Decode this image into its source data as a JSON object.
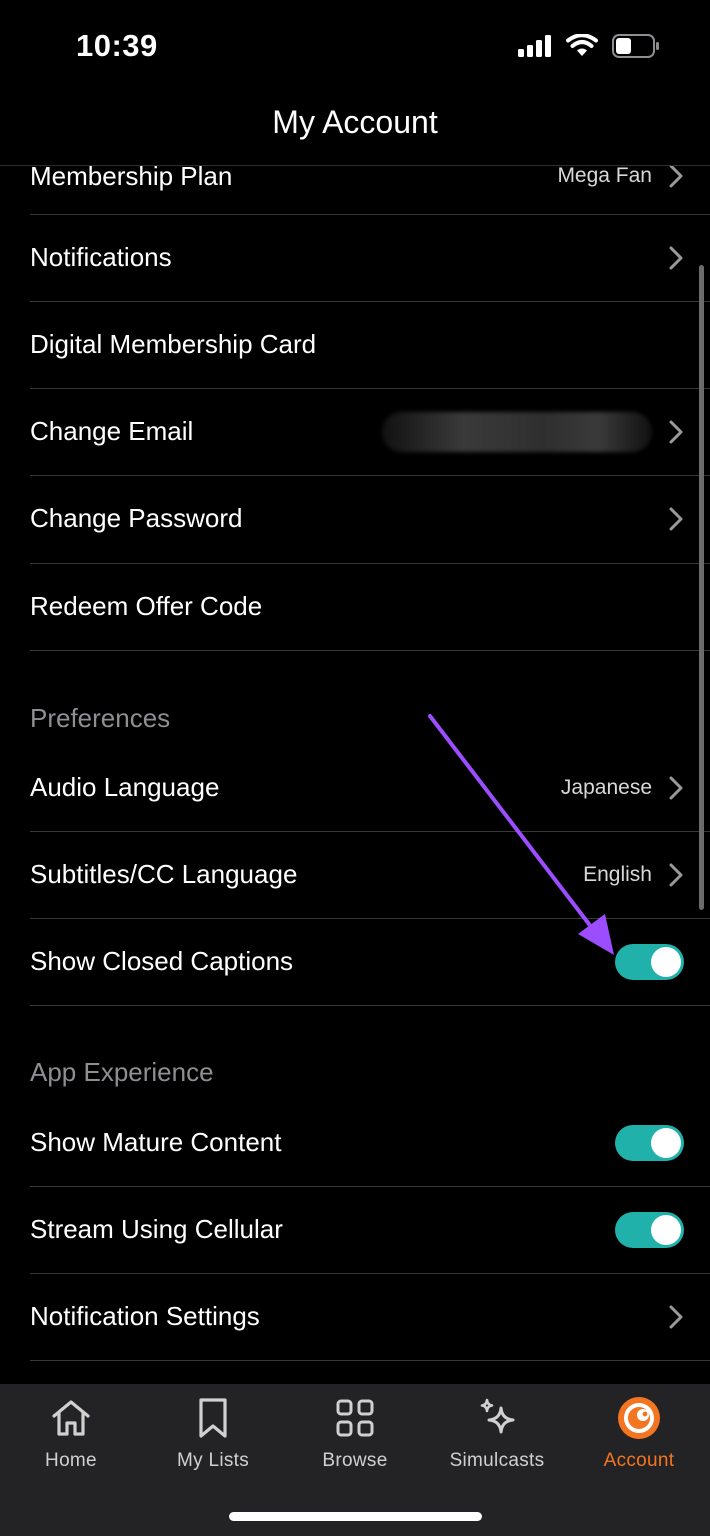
{
  "status_bar": {
    "time": "10:39"
  },
  "nav": {
    "title": "My Account"
  },
  "account_rows": [
    {
      "label": "Membership Plan",
      "value": "Mega Fan"
    },
    {
      "label": "Notifications"
    },
    {
      "label": "Digital Membership Card"
    },
    {
      "label": "Change Email"
    },
    {
      "label": "Change Password"
    },
    {
      "label": "Redeem Offer Code"
    }
  ],
  "preferences": {
    "header": "Preferences",
    "rows": [
      {
        "label": "Audio Language",
        "value": "Japanese"
      },
      {
        "label": "Subtitles/CC Language",
        "value": "English"
      },
      {
        "label": "Show Closed Captions",
        "toggle": true
      }
    ]
  },
  "app_experience": {
    "header": "App Experience",
    "rows": [
      {
        "label": "Show Mature Content",
        "toggle": true
      },
      {
        "label": "Stream Using Cellular",
        "toggle": true
      },
      {
        "label": "Notification Settings"
      }
    ]
  },
  "tabbar": {
    "tabs": [
      {
        "label": "Home",
        "icon": "home-icon"
      },
      {
        "label": "My Lists",
        "icon": "bookmark-icon"
      },
      {
        "label": "Browse",
        "icon": "grid-icon"
      },
      {
        "label": "Simulcasts",
        "icon": "sparkles-icon"
      },
      {
        "label": "Account",
        "icon": "crunchyroll-account-icon",
        "active": true
      }
    ]
  },
  "colors": {
    "toggle_on": "#20b2aa",
    "accent": "#f47521",
    "annotation_arrow": "#9b4dff"
  }
}
